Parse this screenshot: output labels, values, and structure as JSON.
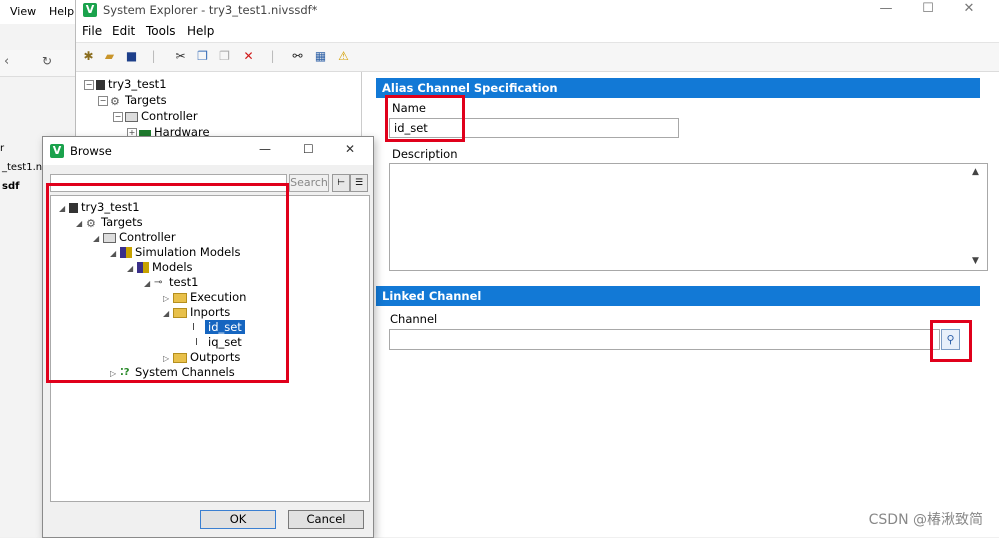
{
  "background_app": {
    "menu": [
      "View",
      "Help"
    ],
    "sidebar_texts": [
      "r",
      "_test1.niv",
      "sdf"
    ]
  },
  "window": {
    "title": "System Explorer - try3_test1.nivssdf*",
    "menu": [
      "File",
      "Edit",
      "Tools",
      "Help"
    ],
    "controls": {
      "minimize": "—",
      "maximize": "☐",
      "close": "✕"
    }
  },
  "tree": {
    "root": "try3_test1",
    "targets": "Targets",
    "controller": "Controller",
    "hardware": "Hardware"
  },
  "alias_section": {
    "header": "Alias Channel Specification",
    "name_label": "Name",
    "name_value": "id_set",
    "description_label": "Description",
    "description_value": ""
  },
  "linked_section": {
    "header": "Linked Channel",
    "channel_label": "Channel",
    "channel_value": ""
  },
  "browse_dialog": {
    "title": "Browse",
    "search_value": "",
    "search_button": "Search",
    "tree": {
      "root": "try3_test1",
      "targets": "Targets",
      "controller": "Controller",
      "simulation_models": "Simulation Models",
      "models": "Models",
      "model": "test1",
      "execution": "Execution",
      "inports": "Inports",
      "inport_1": "id_set",
      "inport_2": "iq_set",
      "outports": "Outports",
      "system_channels": "System Channels"
    },
    "ok_label": "OK",
    "cancel_label": "Cancel",
    "controls": {
      "minimize": "—",
      "maximize": "☐",
      "close": "✕"
    }
  },
  "watermark": "CSDN @椿湫致简",
  "colors": {
    "accent": "#1279d6",
    "highlight": "#e0001b",
    "selection": "#1565c0",
    "logo": "#1aa24c"
  }
}
